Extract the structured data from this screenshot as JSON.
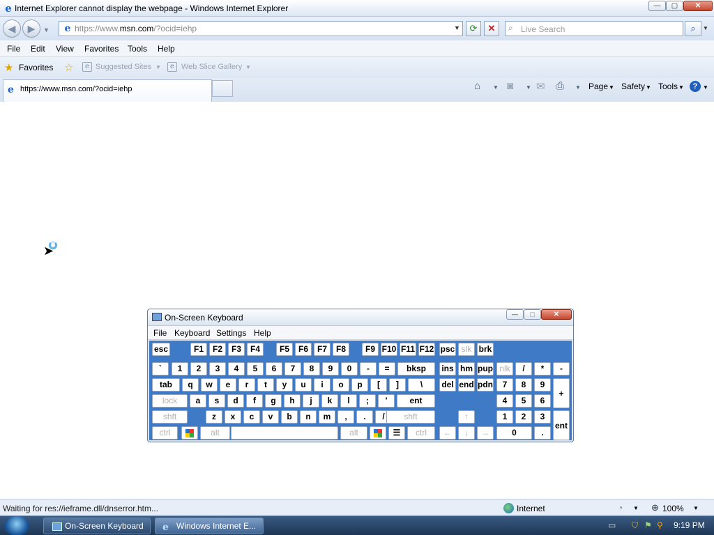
{
  "window": {
    "title": "Internet Explorer cannot display the webpage - Windows Internet Explorer",
    "min_label": "—",
    "max_label": "▢",
    "close_label": "✕"
  },
  "nav": {
    "url_prefix": "https://www.",
    "url_domain": "msn.com",
    "url_suffix": "/?ocid=iehp",
    "search_placeholder": "Live Search"
  },
  "menu": [
    "File",
    "Edit",
    "View",
    "Favorites",
    "Tools",
    "Help"
  ],
  "favorites_bar": {
    "favorites_label": "Favorites",
    "links": [
      "Suggested Sites",
      "Web Slice Gallery"
    ]
  },
  "tab": {
    "label": "https://www.msn.com/?ocid=iehp"
  },
  "command_bar": {
    "page": "Page",
    "safety": "Safety",
    "tools": "Tools"
  },
  "status": {
    "text": "Waiting for res://ieframe.dll/dnserror.htm...",
    "zone": "Internet",
    "zoom": "100%"
  },
  "osk": {
    "title": "On-Screen Keyboard",
    "menu": [
      "File",
      "Keyboard",
      "Settings",
      "Help"
    ],
    "keys": [
      {
        "label": "esc",
        "dim": false
      },
      {
        "label": "F1",
        "dim": false
      },
      {
        "label": "F2",
        "dim": false
      },
      {
        "label": "F3",
        "dim": false
      },
      {
        "label": "F4",
        "dim": false
      },
      {
        "label": "F5",
        "dim": false
      },
      {
        "label": "F6",
        "dim": false
      },
      {
        "label": "F7",
        "dim": false
      },
      {
        "label": "F8",
        "dim": false
      },
      {
        "label": "F9",
        "dim": false
      },
      {
        "label": "F10",
        "dim": false
      },
      {
        "label": "F11",
        "dim": false
      },
      {
        "label": "F12",
        "dim": false
      },
      {
        "label": "psc",
        "dim": false
      },
      {
        "label": "slk",
        "dim": true
      },
      {
        "label": "brk",
        "dim": false
      },
      {
        "label": "`",
        "dim": false
      },
      {
        "label": "1",
        "dim": false
      },
      {
        "label": "2",
        "dim": false
      },
      {
        "label": "3",
        "dim": false
      },
      {
        "label": "4",
        "dim": false
      },
      {
        "label": "5",
        "dim": false
      },
      {
        "label": "6",
        "dim": false
      },
      {
        "label": "7",
        "dim": false
      },
      {
        "label": "8",
        "dim": false
      },
      {
        "label": "9",
        "dim": false
      },
      {
        "label": "0",
        "dim": false
      },
      {
        "label": "-",
        "dim": false
      },
      {
        "label": "=",
        "dim": false
      },
      {
        "label": "bksp",
        "dim": false
      },
      {
        "label": "ins",
        "dim": false
      },
      {
        "label": "hm",
        "dim": false
      },
      {
        "label": "pup",
        "dim": false
      },
      {
        "label": "nlk",
        "dim": true
      },
      {
        "label": "/",
        "dim": false
      },
      {
        "label": "*",
        "dim": false
      },
      {
        "label": "-",
        "dim": false
      },
      {
        "label": "tab",
        "dim": false
      },
      {
        "label": "q",
        "dim": false
      },
      {
        "label": "w",
        "dim": false
      },
      {
        "label": "e",
        "dim": false
      },
      {
        "label": "r",
        "dim": false
      },
      {
        "label": "t",
        "dim": false
      },
      {
        "label": "y",
        "dim": false
      },
      {
        "label": "u",
        "dim": false
      },
      {
        "label": "i",
        "dim": false
      },
      {
        "label": "o",
        "dim": false
      },
      {
        "label": "p",
        "dim": false
      },
      {
        "label": "[",
        "dim": false
      },
      {
        "label": "]",
        "dim": false
      },
      {
        "label": "\\",
        "dim": false
      },
      {
        "label": "del",
        "dim": false
      },
      {
        "label": "end",
        "dim": false
      },
      {
        "label": "pdn",
        "dim": false
      },
      {
        "label": "7",
        "dim": false
      },
      {
        "label": "8",
        "dim": false
      },
      {
        "label": "9",
        "dim": false
      },
      {
        "label": "+",
        "dim": false
      },
      {
        "label": "lock",
        "dim": true
      },
      {
        "label": "a",
        "dim": false
      },
      {
        "label": "s",
        "dim": false
      },
      {
        "label": "d",
        "dim": false
      },
      {
        "label": "f",
        "dim": false
      },
      {
        "label": "g",
        "dim": false
      },
      {
        "label": "h",
        "dim": false
      },
      {
        "label": "j",
        "dim": false
      },
      {
        "label": "k",
        "dim": false
      },
      {
        "label": "l",
        "dim": false
      },
      {
        "label": ";",
        "dim": false
      },
      {
        "label": "'",
        "dim": false
      },
      {
        "label": "ent",
        "dim": false
      },
      {
        "label": "4",
        "dim": false
      },
      {
        "label": "5",
        "dim": false
      },
      {
        "label": "6",
        "dim": false
      },
      {
        "label": "shft",
        "dim": true
      },
      {
        "label": "z",
        "dim": false
      },
      {
        "label": "x",
        "dim": false
      },
      {
        "label": "c",
        "dim": false
      },
      {
        "label": "v",
        "dim": false
      },
      {
        "label": "b",
        "dim": false
      },
      {
        "label": "n",
        "dim": false
      },
      {
        "label": "m",
        "dim": false
      },
      {
        "label": ",",
        "dim": false
      },
      {
        "label": ".",
        "dim": false
      },
      {
        "label": "/",
        "dim": false
      },
      {
        "label": "shft",
        "dim": true
      },
      {
        "label": "↑",
        "dim": true
      },
      {
        "label": "1",
        "dim": false
      },
      {
        "label": "2",
        "dim": false
      },
      {
        "label": "3",
        "dim": false
      },
      {
        "label": "ent",
        "dim": false
      },
      {
        "label": "ctrl",
        "dim": true
      },
      {
        "label": "win",
        "dim": false
      },
      {
        "label": "alt",
        "dim": true
      },
      {
        "label": "",
        "dim": false
      },
      {
        "label": "alt",
        "dim": true
      },
      {
        "label": "win",
        "dim": false
      },
      {
        "label": "menu",
        "dim": false
      },
      {
        "label": "ctrl",
        "dim": true
      },
      {
        "label": "←",
        "dim": true
      },
      {
        "label": "↓",
        "dim": true
      },
      {
        "label": "→",
        "dim": true
      },
      {
        "label": "0",
        "dim": false
      },
      {
        "label": ".",
        "dim": false
      }
    ]
  },
  "taskbar": {
    "osk_label": "On-Screen Keyboard",
    "ie_label": "Windows Internet E...",
    "time": "9:19 PM"
  },
  "colors": {
    "keyboard_bg": "#3f7ac6",
    "taskbar": "#1d3655",
    "dim_key_text": "#b0b0b0"
  }
}
